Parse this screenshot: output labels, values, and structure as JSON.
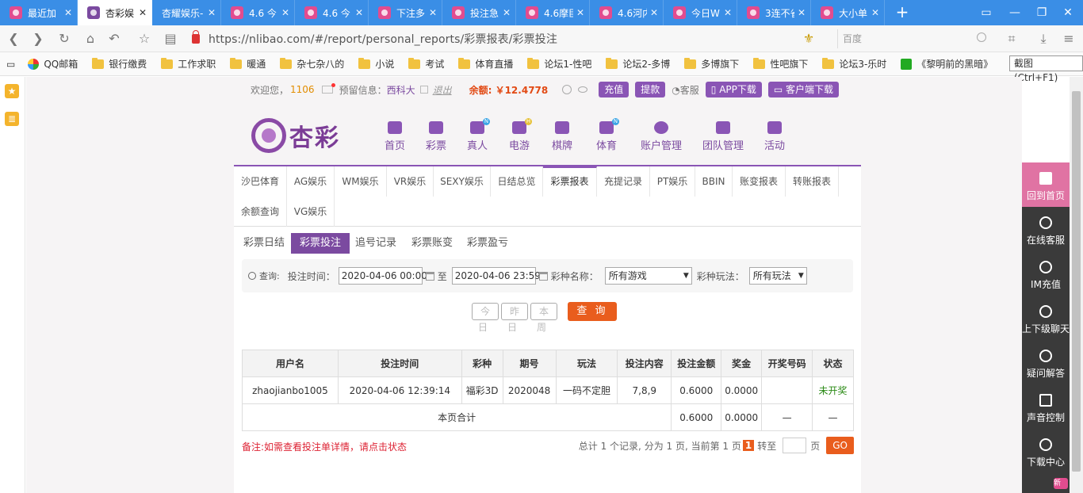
{
  "browser": {
    "tabs": [
      {
        "label": "最近加",
        "active": false
      },
      {
        "label": "杏彩娱",
        "active": true
      },
      {
        "label": "杏耀娱乐-",
        "active": false
      },
      {
        "label": "4.6 今",
        "active": false
      },
      {
        "label": "4.6 今",
        "active": false
      },
      {
        "label": "下注多",
        "active": false
      },
      {
        "label": "投注急",
        "active": false
      },
      {
        "label": "4.6摩臣",
        "active": false
      },
      {
        "label": "4.6河内",
        "active": false
      },
      {
        "label": "今日WI",
        "active": false
      },
      {
        "label": "3连不省",
        "active": false
      },
      {
        "label": "大小单",
        "active": false
      }
    ],
    "url": "https://nlibao.com/#/report/personal_reports/彩票报表/彩票投注",
    "search_placeholder": "百度",
    "bookmarks": [
      "QQ邮箱",
      "银行缴费",
      "工作求职",
      "暖通",
      "杂七杂八的",
      "小说",
      "考试",
      "体育直播",
      "论坛1-性吧",
      "论坛2-多博",
      "多博旗下",
      "性吧旗下",
      "论坛3-乐时",
      "《黎明前的黑暗》"
    ],
    "tooltip": "截图 (Ctrl+F1)"
  },
  "header": {
    "welcome": "欢迎您，",
    "user_id": "1106",
    "reserved_label": "预留信息：",
    "reserved_value": "西科大",
    "logout": "退出",
    "balance": "余额: ￥12.4778",
    "deposit": "充值",
    "withdraw": "提款",
    "service": "客服",
    "app_download": "APP下载",
    "client_download": "客户端下载"
  },
  "logo": {
    "name": "杏彩"
  },
  "main_nav": [
    {
      "label": "首页",
      "badge": ""
    },
    {
      "label": "彩票",
      "badge": ""
    },
    {
      "label": "真人",
      "badge": "N"
    },
    {
      "label": "电游",
      "badge": "H"
    },
    {
      "label": "棋牌",
      "badge": ""
    },
    {
      "label": "体育",
      "badge": "N"
    },
    {
      "label": "账户管理",
      "badge": ""
    },
    {
      "label": "团队管理",
      "badge": ""
    },
    {
      "label": "活动",
      "badge": ""
    }
  ],
  "report_tabs": [
    "沙巴体育",
    "AG娱乐",
    "WM娱乐",
    "VR娱乐",
    "SEXY娱乐",
    "日结总览",
    "彩票报表",
    "充提记录",
    "PT娱乐",
    "BBIN",
    "账变报表",
    "转账报表",
    "余额查询",
    "VG娱乐"
  ],
  "report_tab_active": "彩票报表",
  "lottery_tabs": [
    "彩票日结",
    "彩票投注",
    "追号记录",
    "彩票账变",
    "彩票盈亏"
  ],
  "lottery_tab_active": "彩票投注",
  "query": {
    "icon_label": "查询:",
    "time_label": "投注时间：",
    "start": "2020-04-06 00:00",
    "to": "至",
    "end": "2020-04-06 23:59",
    "lottery_label": "彩种名称：",
    "lottery_value": "所有游戏",
    "play_label": "彩种玩法：",
    "play_value": "所有玩法",
    "quick": [
      "今日",
      "昨日",
      "本周"
    ],
    "submit": "查 询"
  },
  "table": {
    "headers": [
      "用户名",
      "投注时间",
      "彩种",
      "期号",
      "玩法",
      "投注内容",
      "投注金额",
      "奖金",
      "开奖号码",
      "状态"
    ],
    "rows": [
      [
        "zhaojianbo1005",
        "2020-04-06 12:39:14",
        "福彩3D",
        "2020048",
        "一码不定胆",
        "7,8,9",
        "0.6000",
        "0.0000",
        "",
        "未开奖"
      ]
    ],
    "total": {
      "label": "本页合计",
      "amount": "0.6000",
      "bonus": "0.0000",
      "draw": "—",
      "status": "—"
    }
  },
  "note": "备注:如需查看投注单详情，请点击状态",
  "pager": {
    "summary": "总计 1 个记录, 分为 1 页, 当前第 1 页",
    "current": "1",
    "jump": "转至",
    "unit": "页",
    "go": "GO"
  },
  "right_bar": [
    {
      "label": "回到首页",
      "icon": "home-icon"
    },
    {
      "label": "在线客服",
      "icon": "headset-icon"
    },
    {
      "label": "IM充值",
      "icon": "im-icon"
    },
    {
      "label": "上下级聊天",
      "icon": "chat-icon"
    },
    {
      "label": "疑问解答",
      "icon": "question-icon"
    },
    {
      "label": "声音控制",
      "icon": "sound-icon"
    },
    {
      "label": "下载中心",
      "icon": "cloud-icon"
    }
  ],
  "right_bar_new_badge": "新"
}
